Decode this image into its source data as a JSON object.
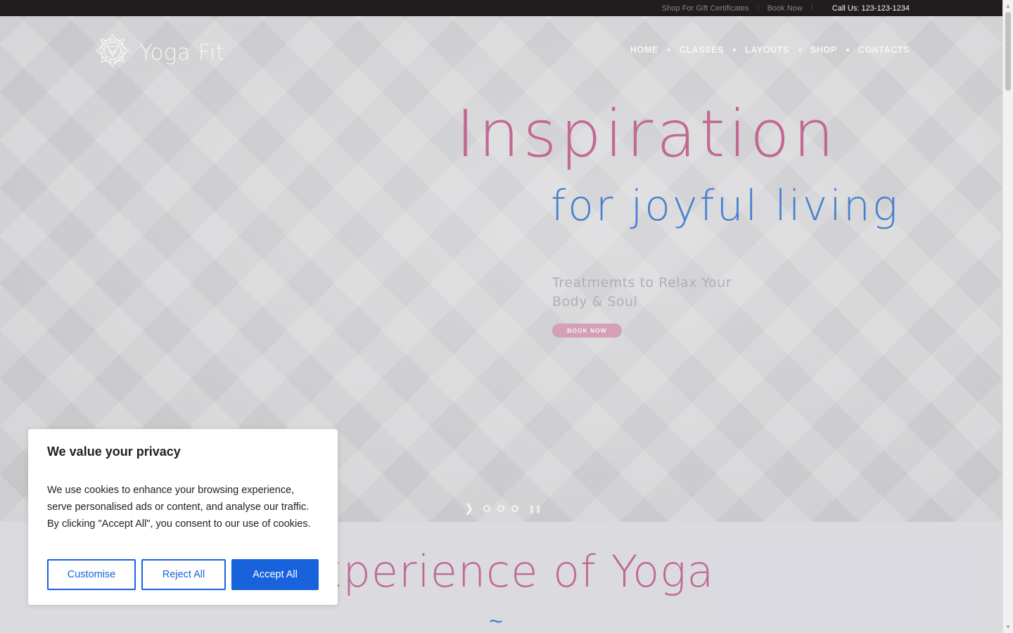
{
  "topbar": {
    "gift_label": "Shop For Gift Certificates",
    "book_label": "Book Now",
    "phone": "Call Us: 123-123-1234"
  },
  "logo": {
    "text": "Yoga Fit",
    "icon": "lotus-mandala-icon"
  },
  "nav": {
    "items": [
      {
        "label": "HOME"
      },
      {
        "label": "CLASSES"
      },
      {
        "label": "LAYOUTS"
      },
      {
        "label": "SHOP"
      },
      {
        "label": "CONTACTS"
      }
    ]
  },
  "hero": {
    "headline": "Inspiration",
    "subline": "for joyful living",
    "tagline": "Treatmemts to Relax Your Body & Soul",
    "button_label": "BOOK NOW",
    "slides_count": 3,
    "active_slide": 1
  },
  "section": {
    "title": "Experience of Yoga",
    "ornament": "~"
  },
  "cookie": {
    "title": "We value your privacy",
    "body": "We use cookies to enhance your browsing experience, serve personalised ads or content, and analyse our traffic. By clicking \"Accept All\", you consent to our use of cookies.",
    "customise_label": "Customise",
    "reject_label": "Reject All",
    "accept_label": "Accept All"
  },
  "colors": {
    "accent_pink": "#c86e9a",
    "accent_blue": "#4a86d8",
    "cookie_blue": "#1863dc",
    "topbar_bg": "#231f20"
  }
}
